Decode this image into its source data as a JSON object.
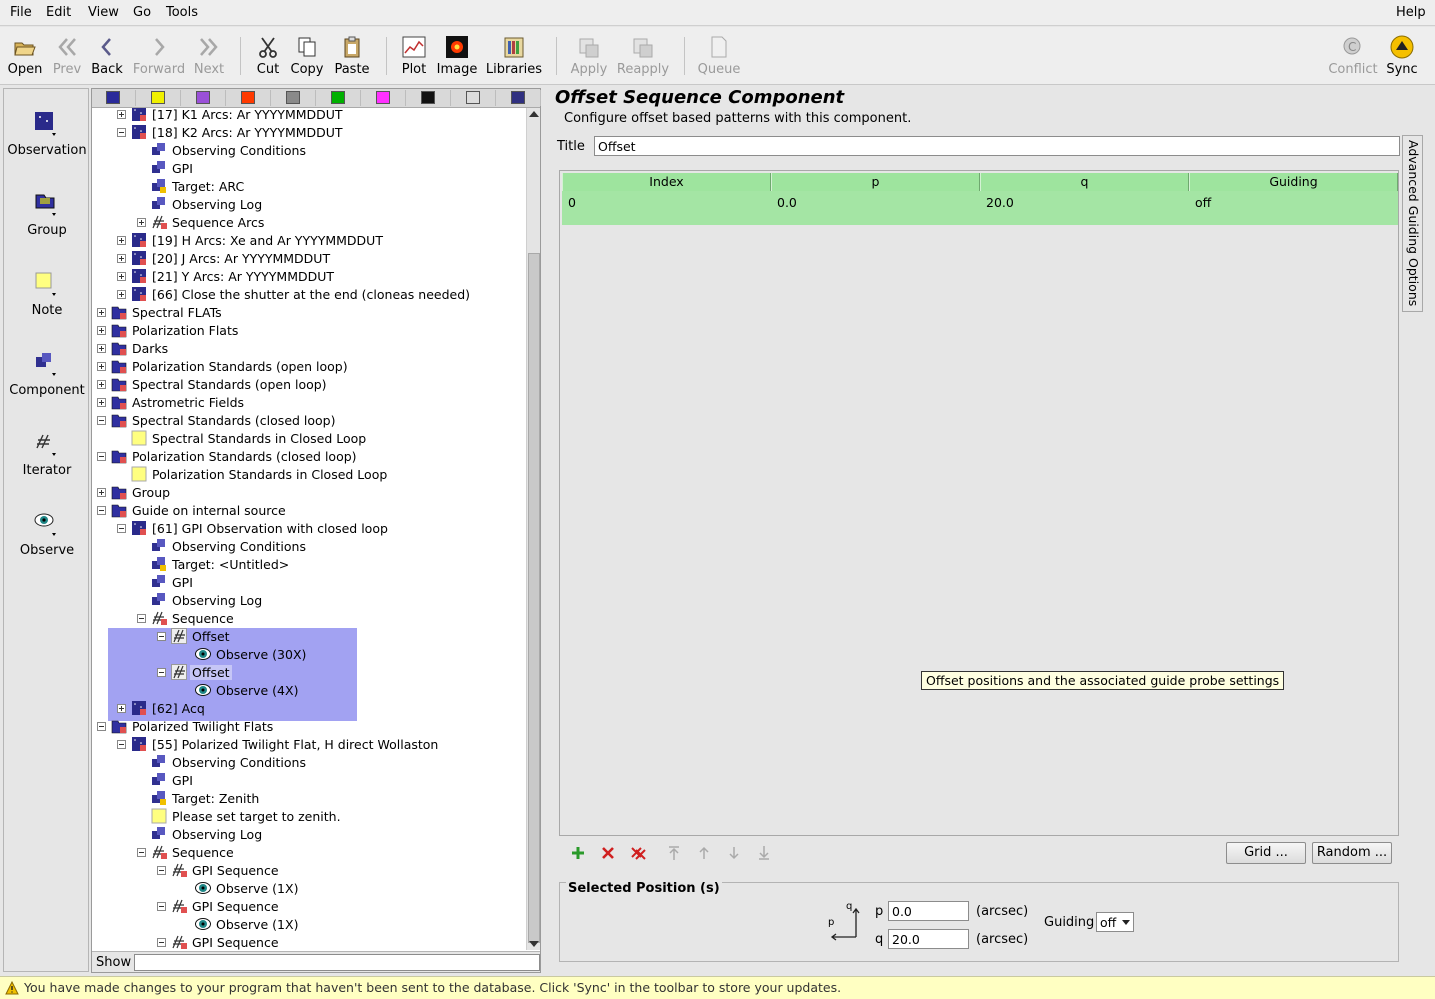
{
  "menu": {
    "file": "File",
    "edit": "Edit",
    "view": "View",
    "go": "Go",
    "tools": "Tools",
    "help": "Help"
  },
  "toolbar": {
    "open": "Open",
    "prev": "Prev",
    "back": "Back",
    "forward": "Forward",
    "next": "Next",
    "cut": "Cut",
    "copy": "Copy",
    "paste": "Paste",
    "plot": "Plot",
    "image": "Image",
    "libraries": "Libraries",
    "apply": "Apply",
    "reapply": "Reapply",
    "queue": "Queue",
    "conflict": "Conflict",
    "sync": "Sync"
  },
  "palette": {
    "observation": "Observation",
    "group": "Group",
    "note": "Note",
    "component": "Component",
    "iterator": "Iterator",
    "observe": "Observe"
  },
  "swatch_colors": [
    "#2a2a9a",
    "#f0f000",
    "#9a50d8",
    "#ff3a00",
    "#8a8a8a",
    "#00b000",
    "#ff30ff",
    "#111111",
    "#dcdcdc",
    "#303080"
  ],
  "tree": [
    {
      "label": "[17] K1 Arcs: Ar YYYYMMDDUT",
      "icon": "observation-icon"
    },
    {
      "label": "[18] K2 Arcs: Ar YYYYMMDDUT",
      "icon": "observation-icon"
    },
    {
      "label": "Observing Conditions",
      "icon": "component-icon"
    },
    {
      "label": "GPI",
      "icon": "component-icon"
    },
    {
      "label": "Target: ARC",
      "icon": "target-icon"
    },
    {
      "label": "Observing Log",
      "icon": "component-icon"
    },
    {
      "label": "Sequence Arcs",
      "icon": "sequence-icon"
    },
    {
      "label": "[19] H Arcs: Xe and Ar YYYYMMDDUT",
      "icon": "observation-icon"
    },
    {
      "label": "[20] J Arcs: Ar YYYYMMDDUT",
      "icon": "observation-icon"
    },
    {
      "label": "[21] Y Arcs: Ar YYYYMMDDUT",
      "icon": "observation-icon"
    },
    {
      "label": "[66] Close the shutter at the end (cloneas needed)",
      "icon": "observation-icon"
    },
    {
      "label": "Spectral FLATs",
      "icon": "group-icon"
    },
    {
      "label": "Polarization Flats",
      "icon": "group-icon"
    },
    {
      "label": "Darks",
      "icon": "group-icon"
    },
    {
      "label": "Polarization Standards (open loop)",
      "icon": "group-icon"
    },
    {
      "label": "Spectral Standards (open loop)",
      "icon": "group-icon"
    },
    {
      "label": "Astrometric Fields",
      "icon": "group-icon"
    },
    {
      "label": "Spectral Standards (closed loop)",
      "icon": "group-icon"
    },
    {
      "label": "Spectral Standards in Closed Loop",
      "icon": "note-icon"
    },
    {
      "label": "Polarization Standards (closed loop)",
      "icon": "group-icon"
    },
    {
      "label": "Polarization Standards in Closed Loop",
      "icon": "note-icon"
    },
    {
      "label": "Group",
      "icon": "group-icon"
    },
    {
      "label": "Guide on internal source",
      "icon": "group-icon"
    },
    {
      "label": "[61] GPI Observation with closed loop",
      "icon": "observation-icon"
    },
    {
      "label": "Observing Conditions",
      "icon": "component-icon"
    },
    {
      "label": "Target: <Untitled>",
      "icon": "target-icon"
    },
    {
      "label": "GPI",
      "icon": "component-icon"
    },
    {
      "label": "Observing Log",
      "icon": "component-icon"
    },
    {
      "label": "Sequence",
      "icon": "sequence-icon"
    },
    {
      "label": "Offset",
      "icon": "offset-icon"
    },
    {
      "label": "Observe (30X)",
      "icon": "observe-icon"
    },
    {
      "label": "Offset",
      "icon": "offset-icon"
    },
    {
      "label": "Observe (4X)",
      "icon": "observe-icon"
    },
    {
      "label": "[62] Acq",
      "icon": "observation-icon"
    },
    {
      "label": "Polarized Twilight Flats",
      "icon": "group-icon"
    },
    {
      "label": "[55] Polarized Twilight Flat, H direct Wollaston",
      "icon": "observation-icon"
    },
    {
      "label": "Observing Conditions",
      "icon": "component-icon"
    },
    {
      "label": "GPI",
      "icon": "component-icon"
    },
    {
      "label": "Target: Zenith",
      "icon": "target-icon"
    },
    {
      "label": "Please set target to zenith.",
      "icon": "note-icon"
    },
    {
      "label": "Observing Log",
      "icon": "component-icon"
    },
    {
      "label": "Sequence",
      "icon": "sequence-icon"
    },
    {
      "label": "GPI Sequence",
      "icon": "sequence-icon"
    },
    {
      "label": "Observe (1X)",
      "icon": "observe-icon"
    },
    {
      "label": "GPI Sequence",
      "icon": "sequence-icon"
    },
    {
      "label": "Observe (1X)",
      "icon": "observe-icon"
    },
    {
      "label": "GPI Sequence",
      "icon": "sequence-icon"
    }
  ],
  "show_label": "Show",
  "editor": {
    "title": "Offset Sequence Component",
    "description": "Configure offset based patterns with this component.",
    "title_label": "Title",
    "title_value": "Offset",
    "side_tab": "Advanced Guiding Options",
    "columns": [
      "Index",
      "p",
      "q",
      "Guiding"
    ],
    "rows": [
      [
        "0",
        "0.0",
        "20.0",
        "off"
      ]
    ],
    "tooltip": "Offset positions and the associated guide probe settings",
    "grid_button": "Grid ...",
    "random_button": "Random ...",
    "selected_legend": "Selected Position (s)",
    "p_label": "p",
    "q_label": "q",
    "p_value": "0.0",
    "q_value": "20.0",
    "unit": "(arcsec)",
    "guiding_label": "Guiding",
    "guiding_value": "off",
    "axis_p": "p",
    "axis_q": "q"
  },
  "status": "You have made changes to your program that haven't been sent to the database.  Click 'Sync' in the toolbar to store your updates."
}
